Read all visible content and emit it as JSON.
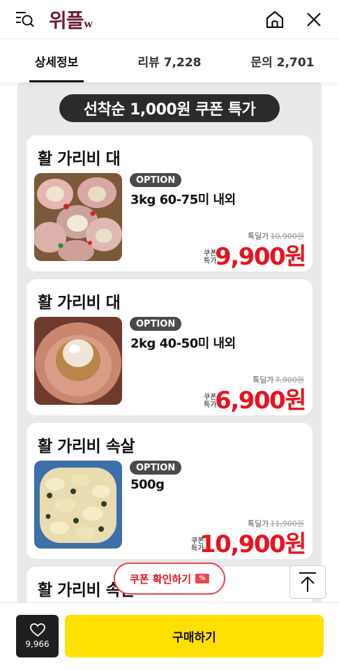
{
  "header": {
    "logo_text": "위플",
    "logo_suffix": "w",
    "icons": [
      "menu-search-icon",
      "home-icon",
      "close-icon"
    ]
  },
  "tabs": [
    {
      "label": "상세정보",
      "active": true
    },
    {
      "label": "리뷰 7,228",
      "active": false
    },
    {
      "label": "문의 2,701",
      "active": false
    }
  ],
  "banner": "선착순 1,000원 쿠폰 특가",
  "option_badge": "OPTION",
  "coupon_label_line1": "쿠폰",
  "coupon_label_line2": "특가",
  "products": [
    {
      "title": "활 가리비 대",
      "option": "3kg 60-75미 내외",
      "orig_label": "톡딜가",
      "orig_price": "10,900원",
      "price": "9,900원"
    },
    {
      "title": "활 가리비 대",
      "option": "2kg 40-50미 내외",
      "orig_label": "톡딜가",
      "orig_price": "7,900원",
      "price": "6,900원"
    },
    {
      "title": "활 가리비 속살",
      "option": "500g",
      "orig_label": "톡딜가",
      "orig_price": "11,900원",
      "price": "10,900원"
    },
    {
      "title": "활 가리비 속살"
    }
  ],
  "coupon_check_button": "쿠폰 확인하기",
  "coupon_ticket_glyph": "%",
  "like_count": "9,966",
  "buy_button": "구매하기",
  "colors": {
    "price_red": "#e8131f",
    "buy_yellow": "#ffe000",
    "logo": "#6b1a3a"
  }
}
